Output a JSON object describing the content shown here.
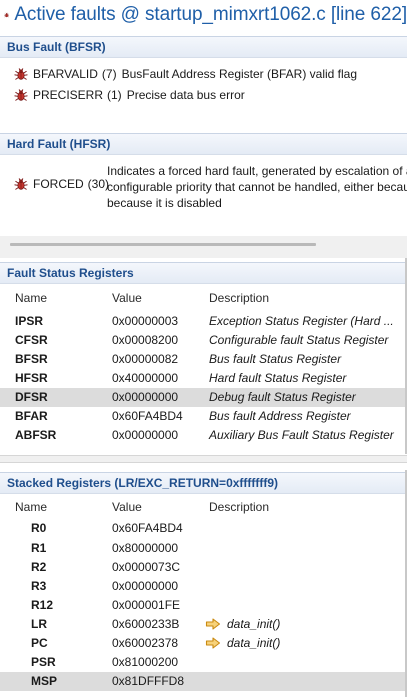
{
  "title": "Active faults @ startup_mimxrt1062.c [line 622]",
  "bus_fault": {
    "header": "Bus Fault (BFSR)",
    "items": [
      {
        "name": "BFARVALID",
        "bit": "(7)",
        "desc": "BusFault Address Register (BFAR) valid flag"
      },
      {
        "name": "PRECISERR",
        "bit": "(1)",
        "desc": "Precise data bus error"
      }
    ]
  },
  "hard_fault": {
    "header": "Hard Fault (HFSR)",
    "item": {
      "name": "FORCED",
      "bit": "(30)"
    },
    "desc_lines": [
      "Indicates a forced hard fault, generated by escalation of a",
      "configurable priority that cannot be handled, either becau",
      "because it is disabled"
    ]
  },
  "fault_status": {
    "header": "Fault Status Registers",
    "columns": {
      "name": "Name",
      "value": "Value",
      "desc": "Description"
    },
    "rows": [
      {
        "name": "IPSR",
        "value": "0x00000003",
        "desc": "Exception Status Register (Hard ..."
      },
      {
        "name": "CFSR",
        "value": "0x00008200",
        "desc": "Configurable fault Status Register"
      },
      {
        "name": "BFSR",
        "value": "0x00000082",
        "desc": "Bus fault Status Register"
      },
      {
        "name": "HFSR",
        "value": "0x40000000",
        "desc": "Hard fault Status Register"
      },
      {
        "name": "DFSR",
        "value": "0x00000000",
        "desc": "Debug fault Status Register"
      },
      {
        "name": "BFAR",
        "value": "0x60FA4BD4",
        "desc": "Bus fault Address Register"
      },
      {
        "name": "ABFSR",
        "value": "0x00000000",
        "desc": "Auxiliary Bus Fault Status Register"
      }
    ],
    "selected": "DFSR"
  },
  "stacked": {
    "header": "Stacked Registers (LR/EXC_RETURN=0xfffffff9)",
    "columns": {
      "name": "Name",
      "value": "Value",
      "desc": "Description"
    },
    "rows": [
      {
        "name": "R0",
        "value": "0x60FA4BD4",
        "desc": ""
      },
      {
        "name": "R1",
        "value": "0x80000000",
        "desc": ""
      },
      {
        "name": "R2",
        "value": "0x0000073C",
        "desc": ""
      },
      {
        "name": "R3",
        "value": "0x00000000",
        "desc": ""
      },
      {
        "name": "R12",
        "value": "0x000001FE",
        "desc": ""
      },
      {
        "name": "LR",
        "value": "0x6000233B",
        "desc": "data_init()",
        "icon": "goto-source-arrow-icon"
      },
      {
        "name": "PC",
        "value": "0x60002378",
        "desc": "data_init()",
        "icon": "goto-source-arrow-icon"
      },
      {
        "name": "PSR",
        "value": "0x81000200",
        "desc": ""
      },
      {
        "name": "MSP",
        "value": "0x81DFFFD8",
        "desc": ""
      }
    ],
    "selected": "MSP"
  },
  "icons": {
    "fault": "bug-icon",
    "link": "goto-source-arrow-icon"
  },
  "colors": {
    "title": "#1f5fa8",
    "section_header": "#1f4e8c",
    "selected_row": "#dcdcdc",
    "arrow": "#e8a317"
  }
}
